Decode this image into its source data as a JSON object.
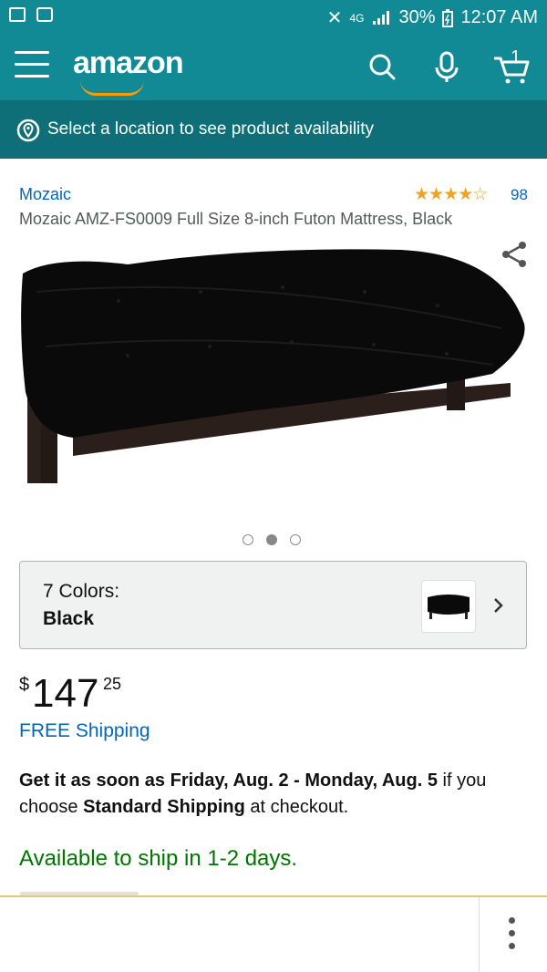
{
  "status_bar": {
    "network": "4G",
    "battery": "30%",
    "time": "12:07 AM"
  },
  "header": {
    "logo": "amazon",
    "cart_count": "1"
  },
  "location_bar": {
    "text": "Select a location to see product availability"
  },
  "product": {
    "brand": "Mozaic",
    "rating_stars": "★★★★☆",
    "rating_value": 3.5,
    "rating_count": "98",
    "title": "Mozaic AMZ-FS0009 Full Size 8-inch Futon Mattress, Black",
    "carousel": {
      "count": 3,
      "active_index": 1
    },
    "color_selector": {
      "label": "7 Colors:",
      "selected": "Black"
    },
    "price": {
      "currency": "$",
      "whole": "147",
      "fraction": "25"
    },
    "shipping": "FREE Shipping",
    "delivery": {
      "prefix": "Get it as soon as Friday, Aug. 2 - Monday, Aug. 5",
      "middle": " if you choose ",
      "method": "Standard Shipping",
      "suffix": " at checkout."
    },
    "availability": "Available to ship in 1-2 days."
  },
  "colors": {
    "header_bg": "#128a96",
    "location_bg": "#0f6f79",
    "link": "#0066c0",
    "star": "#f0a31e",
    "availability": "#007600",
    "logo_smile": "#ff9900"
  },
  "icons": [
    "gallery-icon",
    "screenshot-icon",
    "mute-icon",
    "signal-icon",
    "battery-icon",
    "menu-icon",
    "search-icon",
    "microphone-icon",
    "cart-icon",
    "location-pin-icon",
    "share-icon",
    "chevron-right-icon",
    "more-vertical-icon"
  ]
}
